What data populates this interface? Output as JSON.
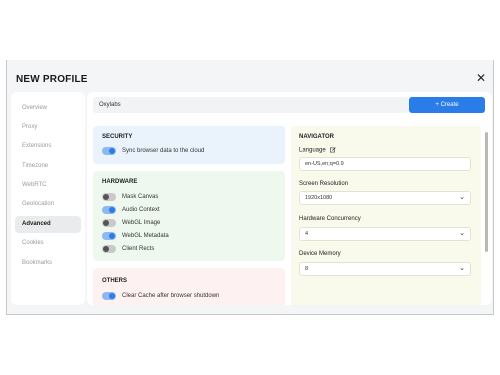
{
  "dialog": {
    "title": "NEW PROFILE",
    "close_label": "✕"
  },
  "sidebar": {
    "items": [
      {
        "label": "Overview"
      },
      {
        "label": "Proxy"
      },
      {
        "label": "Extensions"
      },
      {
        "label": "Timezone"
      },
      {
        "label": "WebRTC"
      },
      {
        "label": "Geolocation"
      },
      {
        "label": "Advanced",
        "active": true
      },
      {
        "label": "Cookies"
      },
      {
        "label": "Bookmarks"
      }
    ]
  },
  "header": {
    "name_value": "Oxylabs",
    "create_label": "+ Create"
  },
  "security": {
    "title": "SECURITY",
    "items": [
      {
        "label": "Sync browser data to the cloud",
        "on": true
      }
    ]
  },
  "hardware": {
    "title": "HARDWARE",
    "items": [
      {
        "label": "Mask Canvas",
        "on": false
      },
      {
        "label": "Audio Context",
        "on": true
      },
      {
        "label": "WebGL Image",
        "on": false
      },
      {
        "label": "WebGL Metadata",
        "on": true
      },
      {
        "label": "Client Rects",
        "on": false
      }
    ]
  },
  "others": {
    "title": "OTHERS",
    "items": [
      {
        "label": "Clear Cache after browser shutdown",
        "on": true
      }
    ]
  },
  "navigator": {
    "title": "NAVIGATOR",
    "language_label": "Language",
    "language_value": "en-US,en;q=0.9",
    "resolution_label": "Screen Resolution",
    "resolution_value": "1920x1080",
    "concurrency_label": "Hardware Concurrency",
    "concurrency_value": "4",
    "memory_label": "Device Memory",
    "memory_value": "8"
  },
  "colors": {
    "accent": "#2a7de8",
    "security_bg": "#eaf3fb",
    "hardware_bg": "#eef8ee",
    "others_bg": "#fdf1f1",
    "navigator_bg": "#f9f9ec"
  },
  "icons": {
    "close": "close-icon",
    "edit": "edit-icon",
    "chevron": "chevron-down-icon"
  }
}
